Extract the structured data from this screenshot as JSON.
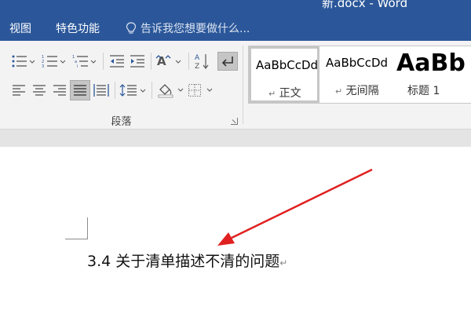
{
  "window": {
    "title": "新.docx - Word"
  },
  "menu": {
    "view": "视图",
    "features": "特色功能",
    "tell_me": "告诉我您想要做什么..."
  },
  "ribbon": {
    "paragraph_group_label": "段落",
    "buttons": [
      "bullets-icon",
      "numbering-icon",
      "multilevel-list-icon",
      "decrease-indent-icon",
      "increase-indent-icon",
      "chinese-layout-icon",
      "sort-icon",
      "show-marks-icon",
      "align-left-icon",
      "align-center-icon",
      "align-right-icon",
      "justify-icon",
      "distributed-icon",
      "line-spacing-icon",
      "shading-icon",
      "borders-icon"
    ]
  },
  "styles": {
    "items": [
      {
        "sample": "AaBbCcDd",
        "name": "正文",
        "mark": "↵"
      },
      {
        "sample": "AaBbCcDd",
        "name": "无间隔",
        "mark": "↵"
      },
      {
        "sample": "AaBb",
        "name": "标题 1"
      }
    ]
  },
  "document": {
    "heading": "3.4 关于清单描述不清的问题",
    "paragraph_mark": "↵"
  },
  "annotation": {
    "color": "#e02020"
  },
  "colors": {
    "ribbon_tab_bar": "#2b579a",
    "ribbon": "#f3f3f3",
    "selected_button": "#c5c5c5"
  }
}
